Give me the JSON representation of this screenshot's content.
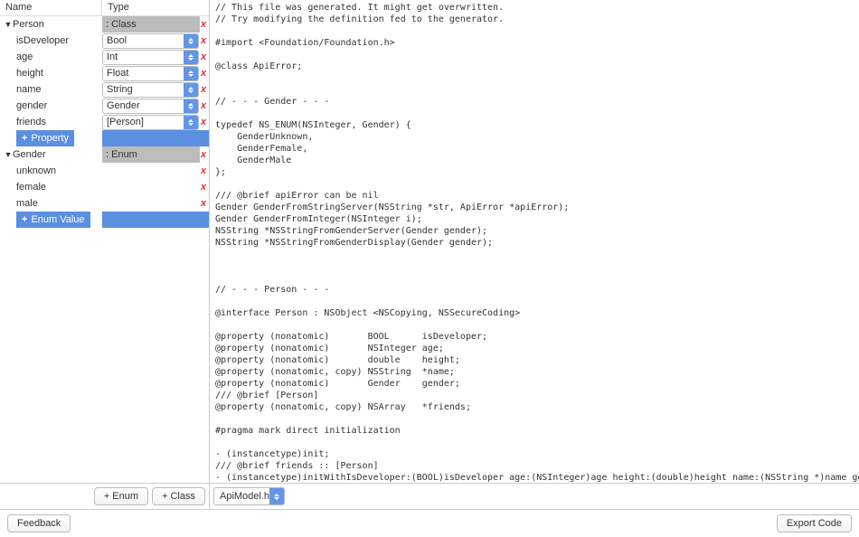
{
  "headers": {
    "name": "Name",
    "type": "Type"
  },
  "model": [
    {
      "name": "Person",
      "kind_label": ": Class",
      "add_label": "Property",
      "props": [
        {
          "name": "isDeveloper",
          "type": "Bool"
        },
        {
          "name": "age",
          "type": "Int"
        },
        {
          "name": "height",
          "type": "Float"
        },
        {
          "name": "name",
          "type": "String"
        },
        {
          "name": "gender",
          "type": "Gender"
        },
        {
          "name": "friends",
          "type": "[Person]"
        }
      ]
    },
    {
      "name": "Gender",
      "kind_label": ": Enum",
      "add_label": "Enum Value",
      "props": [
        {
          "name": "unknown",
          "type": ""
        },
        {
          "name": "female",
          "type": ""
        },
        {
          "name": "male",
          "type": ""
        }
      ]
    }
  ],
  "sidebar_buttons": {
    "enum": "Enum",
    "class": "Class"
  },
  "file_selector": "ApiModel.h",
  "footer": {
    "feedback": "Feedback",
    "export": "Export Code"
  },
  "delete_glyph": "x",
  "plus_glyph": "+",
  "code": "// This file was generated. It might get overwritten.\n// Try modifying the definition fed to the generator.\n\n#import <Foundation/Foundation.h>\n\n@class ApiError;\n\n\n// - - - Gender - - -\n\ntypedef NS_ENUM(NSInteger, Gender) {\n    GenderUnknown,\n    GenderFemale,\n    GenderMale\n};\n\n/// @brief apiError can be nil\nGender GenderFromStringServer(NSString *str, ApiError *apiError);\nGender GenderFromInteger(NSInteger i);\nNSString *NSStringFromGenderServer(Gender gender);\nNSString *NSStringFromGenderDisplay(Gender gender);\n\n\n\n// - - - Person - - -\n\n@interface Person : NSObject <NSCopying, NSSecureCoding>\n\n@property (nonatomic)       BOOL      isDeveloper;\n@property (nonatomic)       NSInteger age;\n@property (nonatomic)       double    height;\n@property (nonatomic, copy) NSString  *name;\n@property (nonatomic)       Gender    gender;\n/// @brief [Person]\n@property (nonatomic, copy) NSArray   *friends;\n\n#pragma mark direct initialization\n\n- (instancetype)init;\n/// @brief friends :: [Person]\n- (instancetype)initWithIsDeveloper:(BOOL)isDeveloper age:(NSInteger)age height:(double)height name:(NSString *)name gender:(Gender)gender\nfriends:(NSArray *)friends NS_DESIGNATED_INITIALIZER;\n/// @brief friends :: [Person]\n+ (instancetype)personWithIsDeveloper:(BOOL)isDeveloper age:(NSInteger)age height:(double)height name:(NSString *)name gender:(Gender)gender\nfriends:(NSArray *)friends;\n\n#pragma mark json initialization\n\n/// @brief 'dict' must be a dictionary representing a JSON structure\n- (instancetype)initWithDict:(NSDictionary *)dict;\n/// @brief 'dict' must be a dictionary representing a JSON structure\n- (instancetype)initWithDict:(NSDictionary *)dict apiError:(ApiError *)apiError;\n/// @brief 'dict' must be a dictionary representing a JSON structure\n+ (instancetype)personWithDict:(NSDictionary *)dict;\n/// @brief 'dict' must be a dictionary representing a JSON structure\n+ (instancetype)personWithDict:(NSDictionary *)dict apiError:(ApiError *)apiError;"
}
